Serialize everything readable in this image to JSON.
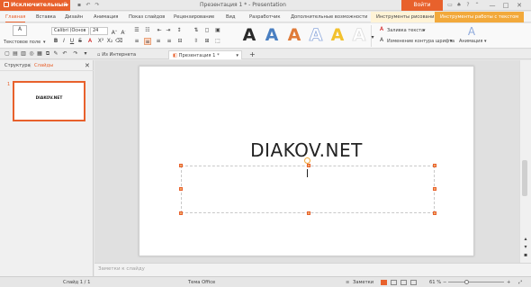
{
  "app": {
    "button_label": "Исключительный",
    "title": "Презентация 1 * - Presentation",
    "login_label": "Войти",
    "window_controls": [
      "—",
      "□",
      "✕"
    ],
    "quick_icons": [
      "minimize-ribbon-icon",
      "shirt-icon",
      "help-icon",
      "collapse-icon"
    ]
  },
  "menu": {
    "tabs": [
      {
        "label": "Главная",
        "active": true
      },
      {
        "label": "Вставка"
      },
      {
        "label": "Дизайн"
      },
      {
        "label": "Анимация"
      },
      {
        "label": "Показ слайдов"
      },
      {
        "label": "Рецензирование"
      },
      {
        "label": "Вид"
      },
      {
        "label": "Разработчик"
      },
      {
        "label": "Дополнительные возможности"
      },
      {
        "label": "Инструменты рисования"
      },
      {
        "label": "Инструменты работы с текстом"
      }
    ]
  },
  "ribbon": {
    "textbox_label": "Текстовое поле",
    "font_name": "Calibri (Основ",
    "font_size": "24",
    "wordart_letter": "A",
    "wordart_colors": [
      "#2a2a2a",
      "#4a7fc1",
      "#e07b39",
      "#8faadc",
      "#f2c12e",
      "#dcdcdc"
    ],
    "text_fill_label": "Заливка текста",
    "text_outline_label": "Изменение контура шрифта",
    "animation_label": "Анимация"
  },
  "doctabs": {
    "tabs": [
      {
        "label": "Из Интернета"
      },
      {
        "label": "Презентация 1 *",
        "active": true
      }
    ],
    "add": "+"
  },
  "side": {
    "tab_structure": "Структура",
    "tab_slides": "Слайды",
    "slide_number": "1",
    "thumb_text": "DIAKOV.NET"
  },
  "slide": {
    "title": "DIAKOV.NET"
  },
  "notes": {
    "placeholder": "Заметки к слайду"
  },
  "status": {
    "slide_info": "Слайд 1 / 1",
    "theme": "Тема Office",
    "notes_label": "Заметки",
    "zoom": "61 %",
    "zoom_fraction": 0.61
  }
}
